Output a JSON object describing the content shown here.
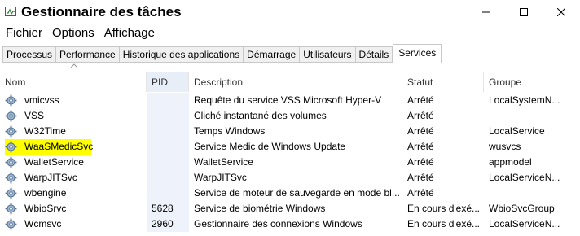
{
  "window": {
    "title": "Gestionnaire des tâches",
    "icon": "task-manager-icon"
  },
  "menu": [
    "Fichier",
    "Options",
    "Affichage"
  ],
  "tabs": {
    "items": [
      "Processus",
      "Performance",
      "Historique des applications",
      "Démarrage",
      "Utilisateurs",
      "Détails",
      "Services"
    ],
    "active": "Services"
  },
  "table": {
    "columns": [
      "Nom",
      "PID",
      "Description",
      "Statut",
      "Groupe"
    ],
    "sorted_column": "PID",
    "rows": [
      {
        "name": "vmicvss",
        "pid": "",
        "description": "Requête du service VSS Microsoft Hyper-V",
        "status": "Arrêté",
        "group": "LocalSystemN...",
        "highlighted": false
      },
      {
        "name": "VSS",
        "pid": "",
        "description": "Cliché instantané des volumes",
        "status": "Arrêté",
        "group": "",
        "highlighted": false
      },
      {
        "name": "W32Time",
        "pid": "",
        "description": "Temps Windows",
        "status": "Arrêté",
        "group": "LocalService",
        "highlighted": false
      },
      {
        "name": "WaaSMedicSvc",
        "pid": "",
        "description": "Service Medic de Windows Update",
        "status": "Arrêté",
        "group": "wusvcs",
        "highlighted": true
      },
      {
        "name": "WalletService",
        "pid": "",
        "description": "WalletService",
        "status": "Arrêté",
        "group": "appmodel",
        "highlighted": false
      },
      {
        "name": "WarpJITSvc",
        "pid": "",
        "description": "WarpJITSvc",
        "status": "Arrêté",
        "group": "LocalServiceN...",
        "highlighted": false
      },
      {
        "name": "wbengine",
        "pid": "",
        "description": "Service de moteur de sauvegarde en mode bl...",
        "status": "Arrêté",
        "group": "",
        "highlighted": false
      },
      {
        "name": "WbioSrvc",
        "pid": "5628",
        "description": "Service de biométrie Windows",
        "status": "En cours d'exé...",
        "group": "WbioSvcGroup",
        "highlighted": false
      },
      {
        "name": "Wcmsvc",
        "pid": "2960",
        "description": "Gestionnaire des connexions Windows",
        "status": "En cours d'exé...",
        "group": "LocalServiceN...",
        "highlighted": false
      }
    ]
  },
  "colors": {
    "highlight": "#ffff00",
    "sorted_column_bg": "#eef2fa",
    "row_icon": "#6a8fb8"
  }
}
